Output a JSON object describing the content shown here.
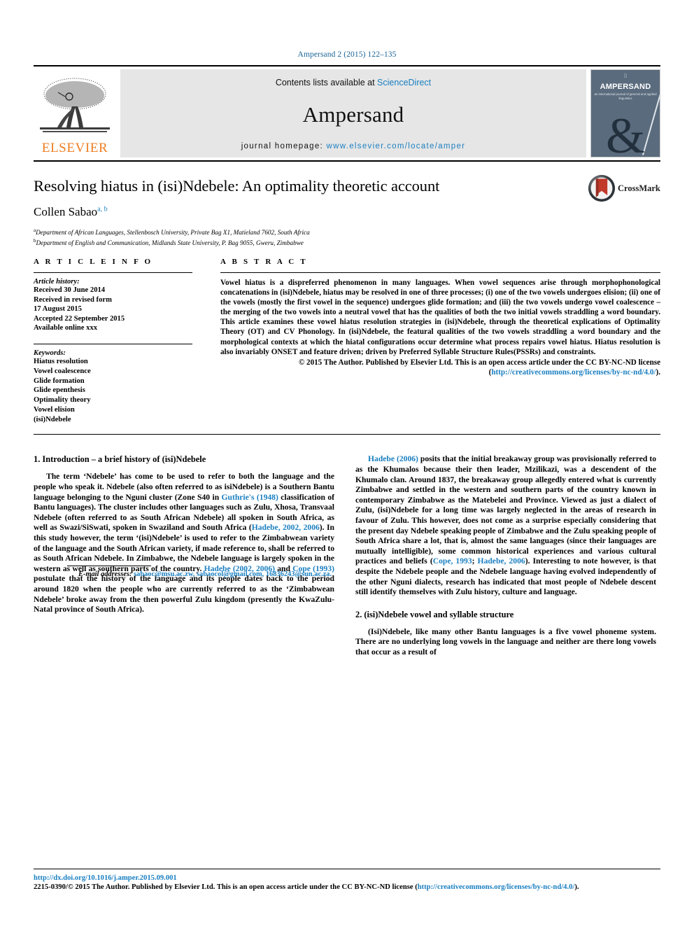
{
  "running_head": "Ampersand 2 (2015) 122–135",
  "masthead": {
    "contents_prefix": "Contents lists available at ",
    "sciencedirect": "ScienceDirect",
    "journal_name": "Ampersand",
    "homepage_prefix": "journal homepage: ",
    "homepage_url": "www.elsevier.com/locate/amper",
    "publisher": "ELSEVIER",
    "cover": {
      "title": "AMPERSAND",
      "subtitle": "an international journal of\ngeneral and applied linguistics",
      "ampersand_glyph": "&"
    }
  },
  "article": {
    "title": "Resolving hiatus in (isi)Ndebele: An optimality theoretic account",
    "authors": "Collen Sabao",
    "author_marks": "a, b",
    "affiliations": [
      {
        "mark": "a",
        "text": "Department of African Languages, Stellenbosch University, Private Bag X1, Matieland 7602, South Africa"
      },
      {
        "mark": "b",
        "text": "Department of English and Communication, Midlands State University, P. Bag 9055, Gweru, Zimbabwe"
      }
    ],
    "crossmark_label": "CrossMark"
  },
  "article_info": {
    "heading": "A R T I C L E   I N F O",
    "history_label": "Article history:",
    "history": [
      "Received 30 June 2014",
      "Received in revised form",
      "17 August 2015",
      "Accepted 22 September 2015",
      "Available online xxx"
    ],
    "keywords_label": "Keywords:",
    "keywords": [
      "Hiatus resolution",
      "Vowel coalescence",
      "Glide formation",
      "Glide epenthesis",
      "Optimality theory",
      "Vowel elision",
      "(isi)Ndebele"
    ]
  },
  "abstract": {
    "heading": "A B S T R A C T",
    "text": "Vowel hiatus is a dispreferred phenomenon in many languages. When vowel sequences arise through morphophonological concatenations in (isi)Ndebele, hiatus may be resolved in one of three processes; (i) one of the two vowels undergoes elision; (ii) one of the vowels (mostly the first vowel in the sequence) undergoes glide formation; and (iii) the two vowels undergo vowel coalescence – the merging of the two vowels into a neutral vowel that has the qualities of both the two initial vowels straddling a word boundary. This article examines these vowel hiatus resolution strategies in (isi)Ndebele, through the theoretical explications of Optimality Theory (OT) and CV Phonology. In (isi)Ndebele, the featural qualities of the two vowels straddling a word boundary and the morphological contexts at which the hiatal configurations occur determine what process repairs vowel hiatus. Hiatus resolution is also invariably ONSET and feature driven; driven by Preferred Syllable Structure Rules(PSSRs) and constraints.",
    "copyright_text": "© 2015 The Author. Published by Elsevier Ltd. This is an open access article under the CC BY-NC-ND license (",
    "copyright_url": "http://creativecommons.org/licenses/by-nc-nd/4.0/",
    "copyright_tail": ")."
  },
  "sections": {
    "s1_heading": "1. Introduction – a brief history of (isi)Ndebele",
    "s1_p1_a": "The term ‘Ndebele’ has come to be used to refer to both the language and the people who speak it. Ndebele (also often referred to as isiNdebele) is a Southern Bantu language belonging to the Nguni cluster (Zone S40 in ",
    "s1_ref1": "Guthrie's (1948)",
    "s1_p1_b": " classification of Bantu languages). The cluster includes other languages such as Zulu, Xhosa, Transvaal Ndebele (often referred to as South African Ndebele) all spoken in South Africa, as well as Swazi/SiSwati, spoken in Swaziland and South Africa (",
    "s1_ref2": "Hadebe, 2002, 2006",
    "s1_p1_c": "). In this study however, the term ‘(isi)Ndebele’ is used to refer to the Zimbabwean variety of the language and the South African variety, if made reference to, shall be referred to as South African Ndebele. In Zimbabwe, the Ndebele language is largely spoken in the western as well as southern parts of the country. ",
    "s1_ref3": "Hadebe (2002, 2006)",
    "s1_p1_d": " and ",
    "s1_ref4": "Cope (1993)",
    "s1_p1_e": " postulate that the history of the language and its people dates back to the period around 1820 when the people who are currently referred to as the ‘Zimbabwean Ndebele’ broke away from the then powerful Zulu kingdom (presently the KwaZulu-Natal province of South Africa).",
    "s1_ref5": "Hadebe (2006)",
    "s1_p2_a": " posits that the initial breakaway group was provisionally referred to as the Khumalos because their then leader, Mzilikazi, was a descendent of the Khumalo clan. Around 1837, the breakaway group allegedly entered what is currently Zimbabwe and settled in the western and southern parts of the country known in contemporary Zimbabwe as the Matebelei and Province. Viewed as just a dialect of Zulu, (isi)Ndebele for a long time was largely neglected in the areas of research in favour of Zulu. This however, does not come as a surprise especially considering that the present day Ndebele speaking people of Zimbabwe and the Zulu speaking people of South Africa share a lot, that is, almost the same languages (since their languages are mutually intelligible), some common historical experiences and various cultural practices and beliefs (",
    "s1_ref6": "Cope, 1993",
    "s1_p2_b": "; ",
    "s1_ref7": "Hadebe, 2006",
    "s1_p2_c": "). Interesting to note however, is that despite the Ndebele people and the Ndebele language having evolved independently of the other Nguni dialects, research has indicated that most people of Ndebele descent still identify themselves with Zulu history, culture and language.",
    "s2_heading": "2. (isi)Ndebele vowel and syllable structure",
    "s2_p1": "(Isi)Ndebele, like many other Bantu languages is a five vowel phoneme system. There are no underlying long vowels in the language and neither are there long vowels that occur as a result of"
  },
  "footnote": {
    "label": "E-mail addresses:",
    "emails": "sabaoc@msu.ac.zw, sabaocol@gmail.com, 16836243@sun.ac.za."
  },
  "footer": {
    "doi": "http://dx.doi.org/10.1016/j.amper.2015.09.001",
    "issn_line_a": "2215-0390/© 2015 The Author. Published by Elsevier Ltd. This is an open access article under the CC BY-NC-ND license (",
    "issn_url": "http://creativecommons.org/licenses/by-nc-nd/4.0/",
    "issn_line_b": ")."
  },
  "colors": {
    "link": "#1a7fc1",
    "running_head": "#1a6496",
    "elsevier_orange": "#ef7d21",
    "masthead_bg": "#e6e6e6",
    "cover_bg": "#5a6b7d"
  }
}
